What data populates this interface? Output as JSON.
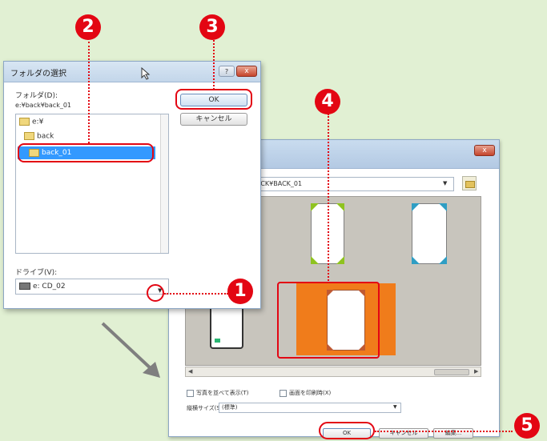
{
  "folder_dialog": {
    "title": "フォルダの選択",
    "folder_label": "フォルダ(D):",
    "folder_path": "e:¥back¥back_01",
    "tree_items": [
      "e:¥",
      "back",
      "back_01"
    ],
    "ok_label": "OK",
    "cancel_label": "キャンセル",
    "drive_label": "ドライブ(V):",
    "drive_value": "e: CD_02",
    "help_label": "?",
    "close_label": "x"
  },
  "image_dialog": {
    "close_label": "x",
    "path_value": "ACK¥BACK_01",
    "checkbox1_label": "写真を並べて表示(T)",
    "checkbox2_label": "画面を印刷時(X)",
    "size_label": "縦横サイズ(S):",
    "size_value": "(標準)",
    "ok_label": "OK",
    "cancel_label": "キャンセル",
    "extra_label": "編集..."
  },
  "annotations": {
    "step1": "1",
    "step2": "2",
    "step3": "3",
    "step4": "4",
    "step5": "5"
  },
  "colors": {
    "background": "#e1f0d3",
    "annotation_red": "#e30613",
    "selection_blue": "#3399ff",
    "highlight_orange": "#f07c1b",
    "card_green": "#8fc31f",
    "card_blue": "#2f9ec4"
  }
}
